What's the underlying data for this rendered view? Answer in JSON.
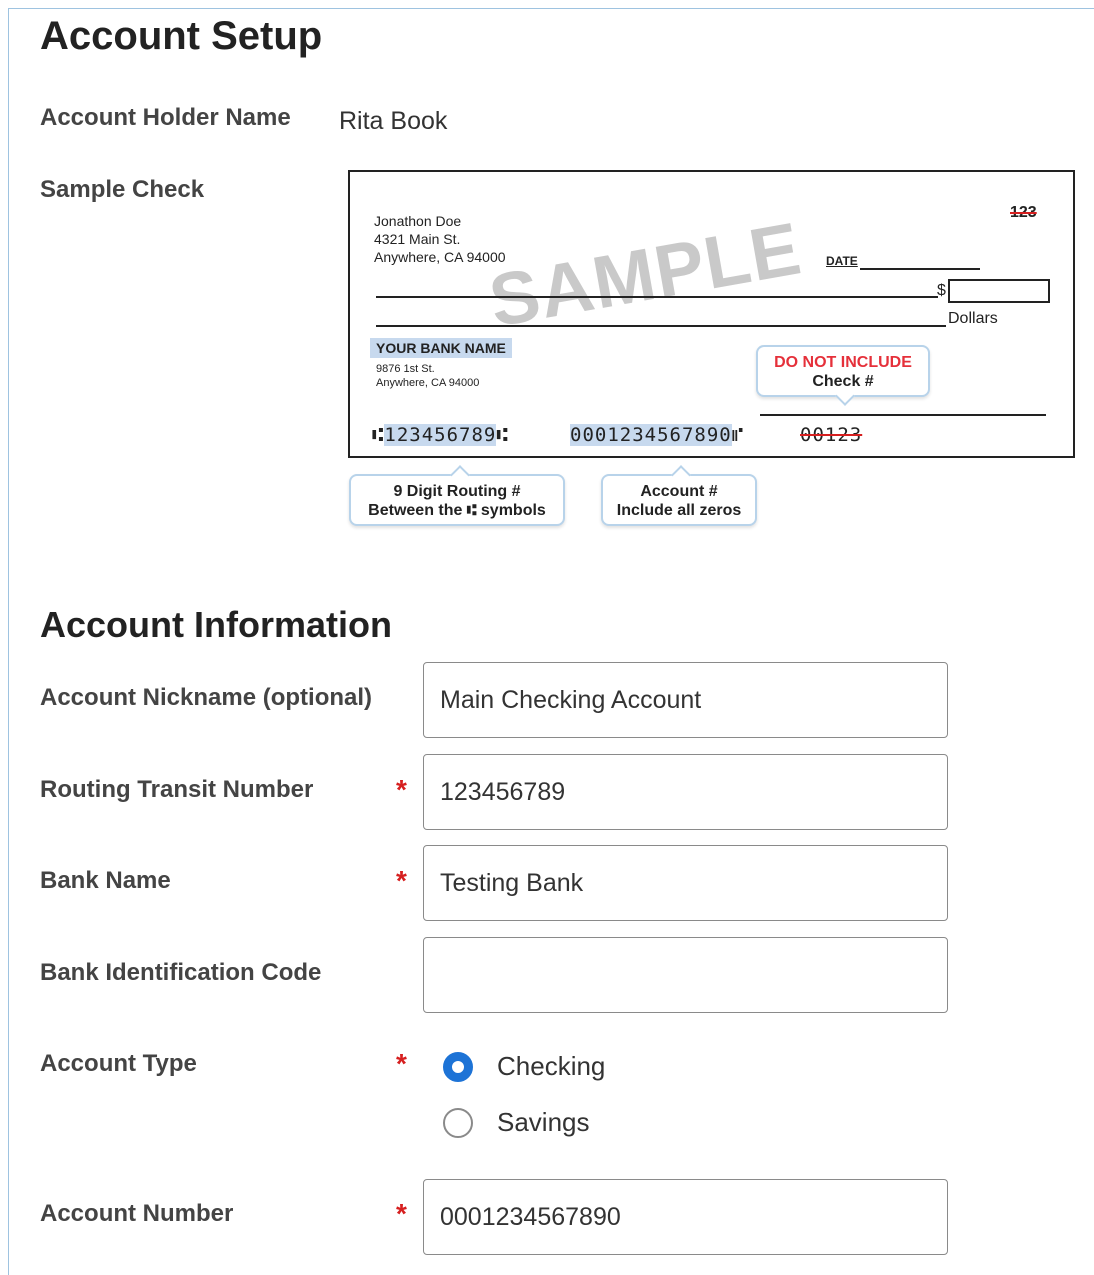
{
  "setup": {
    "title": "Account Setup",
    "holder_label": "Account Holder Name",
    "holder_value": "Rita Book",
    "sample_check_label": "Sample Check"
  },
  "check": {
    "name": "Jonathon Doe",
    "address1": "4321 Main St.",
    "address2": "Anywhere, CA 94000",
    "check_no": "123",
    "watermark": "SAMPLE",
    "date_label": "DATE",
    "dollar_sign": "$",
    "dollars_label": "Dollars",
    "bank_name": "YOUR BANK NAME",
    "bank_addr1": "9876 1st St.",
    "bank_addr2": "Anywhere, CA 94000",
    "micr_routing_open": "⑆",
    "micr_routing": "123456789",
    "micr_routing_close": "⑆",
    "micr_account": "0001234567890",
    "micr_account_sep": "⑈",
    "micr_check": "00123",
    "callout_no_include_1": "DO NOT INCLUDE",
    "callout_no_include_2": "Check #",
    "callout_routing_1": "9 Digit  Routing #",
    "callout_routing_2": "Between the ⑆ symbols",
    "callout_account_1": "Account #",
    "callout_account_2": "Include all zeros"
  },
  "info": {
    "title": "Account Information",
    "nickname_label": "Account Nickname (optional)",
    "nickname_value": "Main Checking Account",
    "routing_label": "Routing Transit Number",
    "routing_value": "123456789",
    "bank_label": "Bank Name",
    "bank_value": "Testing Bank",
    "bic_label": "Bank Identification Code",
    "bic_value": "",
    "type_label": "Account Type",
    "type_options": [
      "Checking",
      "Savings"
    ],
    "type_selected": "Checking",
    "number_label": "Account Number",
    "number_value": "0001234567890",
    "required_mark": "*"
  },
  "colors": {
    "required": "#d61f1f",
    "radio_selected": "#1d73d6",
    "highlight": "#c7d9ee"
  }
}
